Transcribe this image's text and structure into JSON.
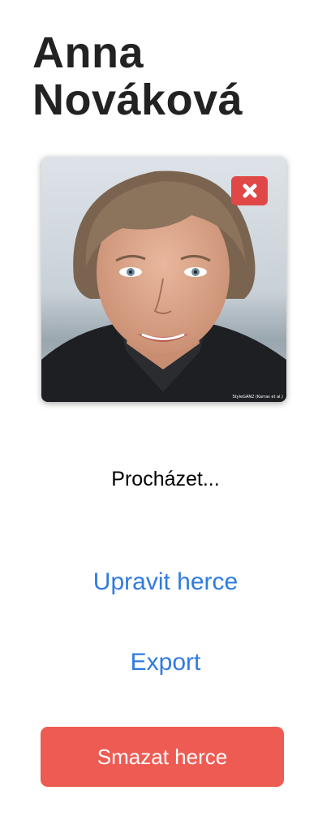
{
  "actor": {
    "name_line1": "Anna",
    "name_line2": "Nováková"
  },
  "photo": {
    "watermark": "StyleGAN2 (Karras et al.)",
    "remove_icon": "close-x-icon"
  },
  "actions": {
    "browse_label": "Procházet...",
    "edit_label": "Upravit herce",
    "export_label": "Export",
    "delete_label": "Smazat herce"
  },
  "colors": {
    "title": "#222222",
    "link": "#2f7be0",
    "remove_button": "#e04848",
    "delete_button": "#ee5b53"
  }
}
